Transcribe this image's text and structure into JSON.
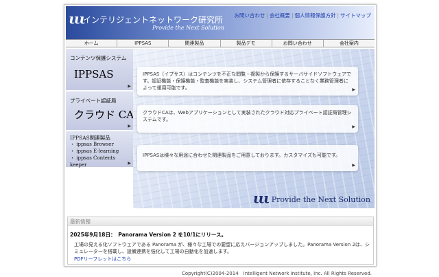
{
  "header": {
    "logo_mark": "ιιι",
    "site_title": "インテリジェントネットワーク研究所",
    "tagline": "Provide the Next Solution",
    "toplinks": [
      "お問い合わせ",
      "会社概要",
      "個人情報保護方針",
      "サイトマップ"
    ],
    "separator": "|"
  },
  "nav": [
    "ホーム",
    "IPPSAS",
    "関連製品",
    "製品デモ",
    "お問い合わせ",
    "会社案内"
  ],
  "sidebar": {
    "box1": {
      "caption": "コンテンツ保護システム",
      "title": "IPPSAS"
    },
    "box2": {
      "caption": "プライベート認証局",
      "title": "クラウド CA"
    },
    "box3": {
      "caption": "IPPSAS関連製品",
      "items": [
        "・ ippsas Browser",
        "・ ippsas E-learning",
        "・ ippsas Contents keeper"
      ]
    },
    "arrow": "▶"
  },
  "main": {
    "cards": [
      "IPPSAS（イプサス）はコンテンツを不正な閲覧・複製から保護するサーバサイドソフトウェアです。認証機能・保護機能・監査機能を実装し、システム管理者に依存することなく業務管理者によって運用可能です。",
      "クラウドCAは、Webアプリケーションとして実装されたクラウド対応プライベート認証局管理システムです。",
      "IPPSASは様々な用途に合わせた関連製品をご用意しております。カスタマイズも可能です。"
    ],
    "brand_mark": "ιιι",
    "brand_text": "Provide the Next Solution"
  },
  "news": {
    "heading": "最新情報",
    "title": "2025年9月18日：　Panorama Version 2 を10/1にリリース。",
    "body": "工場の見える化ソフトウェアである Panorama が、様々な工場での要望に応えバージョンアップしました。Panorama Version 2は、シミュレーターを搭載し、設備連携を強化して工場の自動化を加速します。",
    "link": "PDFリーフレットはこちら"
  },
  "footer": {
    "copyright": "Copyright(C)2004-2014　Intelligent Network Institute, Inc. All Rights Reserved."
  }
}
